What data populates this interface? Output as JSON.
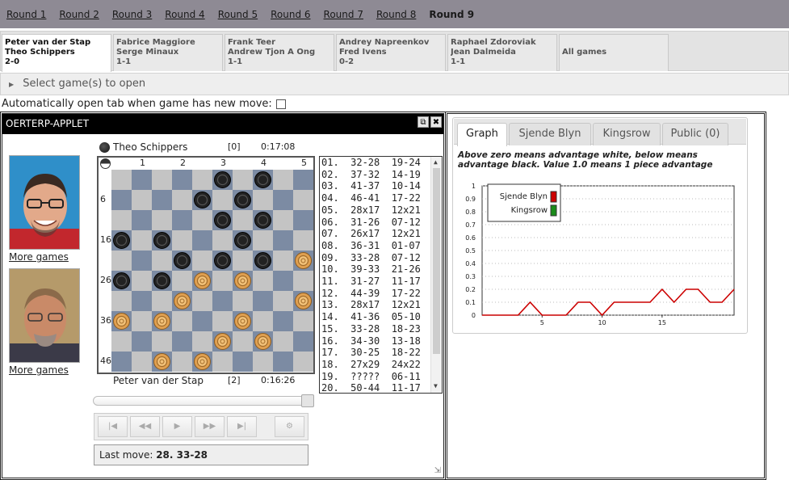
{
  "rounds": [
    {
      "label": "Round 1",
      "current": false
    },
    {
      "label": "Round 2",
      "current": false
    },
    {
      "label": "Round 3",
      "current": false
    },
    {
      "label": "Round 4",
      "current": false
    },
    {
      "label": "Round 5",
      "current": false
    },
    {
      "label": "Round 6",
      "current": false
    },
    {
      "label": "Round 7",
      "current": false
    },
    {
      "label": "Round 8",
      "current": false
    },
    {
      "label": "Round 9",
      "current": true
    }
  ],
  "game_tabs": [
    {
      "white": "Peter van der Stap",
      "black": "Theo Schippers",
      "score": "2-0",
      "active": true
    },
    {
      "white": "Fabrice Maggiore",
      "black": "Serge Minaux",
      "score": "1-1",
      "active": false
    },
    {
      "white": "Frank Teer",
      "black": "Andrew Tjon A Ong",
      "score": "1-1",
      "active": false
    },
    {
      "white": "Andrey Napreenkov",
      "black": "Fred Ivens",
      "score": "0-2",
      "active": false
    },
    {
      "white": "Raphael Zdoroviak",
      "black": "Jean Dalmeida",
      "score": "1-1",
      "active": false
    },
    {
      "white": "All games",
      "black": "",
      "score": "",
      "active": false
    }
  ],
  "select_games_label": "Select game(s) to open",
  "auto_open_label": "Automatically open tab when game has new move:",
  "auto_open_checked": false,
  "applet": {
    "title": "OERTERP-APPLET",
    "more_games": "More games",
    "black_player": {
      "name": "Theo Schippers",
      "score": "[0]",
      "clock": "0:17:08"
    },
    "white_player": {
      "name": "Peter van der Stap",
      "score": "[2]",
      "clock": "0:16:26"
    },
    "board": {
      "col_labels": [
        "1",
        "2",
        "3",
        "4",
        "5"
      ],
      "row_labels": [
        "6",
        "16",
        "26",
        "36",
        "46"
      ],
      "black_pieces": [
        3,
        4,
        8,
        9,
        13,
        14,
        16,
        17,
        19,
        22,
        23,
        24,
        26,
        27
      ],
      "white_pieces": [
        25,
        28,
        29,
        32,
        35,
        36,
        37,
        39,
        43,
        44,
        47,
        48
      ]
    },
    "moves": [
      "01.  32-28  19-24",
      "02.  37-32  14-19",
      "03.  41-37  10-14",
      "04.  46-41  17-22",
      "05.  28x17  12x21",
      "06.  31-26  07-12",
      "07.  26x17  12x21",
      "08.  36-31  01-07",
      "09.  33-28  07-12",
      "10.  39-33  21-26",
      "11.  31-27  11-17",
      "12.  44-39  17-22",
      "13.  28x17  12x21",
      "14.  41-36  05-10",
      "15.  33-28  18-23",
      "16.  34-30  13-18",
      "17.  30-25  18-22",
      "18.  27x29  24x22",
      "19.  ?????  06-11",
      "20.  50-44  11-17"
    ],
    "last_move_label": "Last move:",
    "last_move_value": "28. 33-28"
  },
  "graph_panel": {
    "tabs": [
      {
        "label": "Graph",
        "active": true
      },
      {
        "label": "Sjende Blyn",
        "active": false
      },
      {
        "label": "Kingsrow",
        "active": false
      },
      {
        "label": "Public (0)",
        "active": false
      }
    ],
    "explanation": "Above zero means advantage white, below means advantage black. Value 1.0 means 1 piece advantage"
  },
  "chart_data": {
    "type": "line",
    "title": "",
    "xlabel": "",
    "ylabel": "",
    "ylim": [
      0,
      1
    ],
    "xlim": [
      0,
      21
    ],
    "y_ticks": [
      "0",
      "0.1",
      "0.2",
      "0.3",
      "0.4",
      "0.5",
      "0.6",
      "0.7",
      "0.8",
      "0.9",
      "1"
    ],
    "x_ticks": [
      "5",
      "10",
      "15"
    ],
    "grid": true,
    "legend_placement": "top-left",
    "series": [
      {
        "name": "Sjende Blyn",
        "color": "#cc0000",
        "x": [
          0,
          1,
          2,
          3,
          4,
          5,
          6,
          7,
          8,
          9,
          10,
          11,
          12,
          13,
          14,
          15,
          16,
          17,
          18,
          19,
          20,
          21
        ],
        "values": [
          0,
          0,
          0,
          0,
          0.1,
          0,
          0,
          0,
          0.1,
          0.1,
          0,
          0.1,
          0.1,
          0.1,
          0.1,
          0.2,
          0.1,
          0.2,
          0.2,
          0.1,
          0.1,
          0.2
        ]
      },
      {
        "name": "Kingsrow",
        "color": "#1a8c1a",
        "x": [],
        "values": []
      }
    ]
  }
}
